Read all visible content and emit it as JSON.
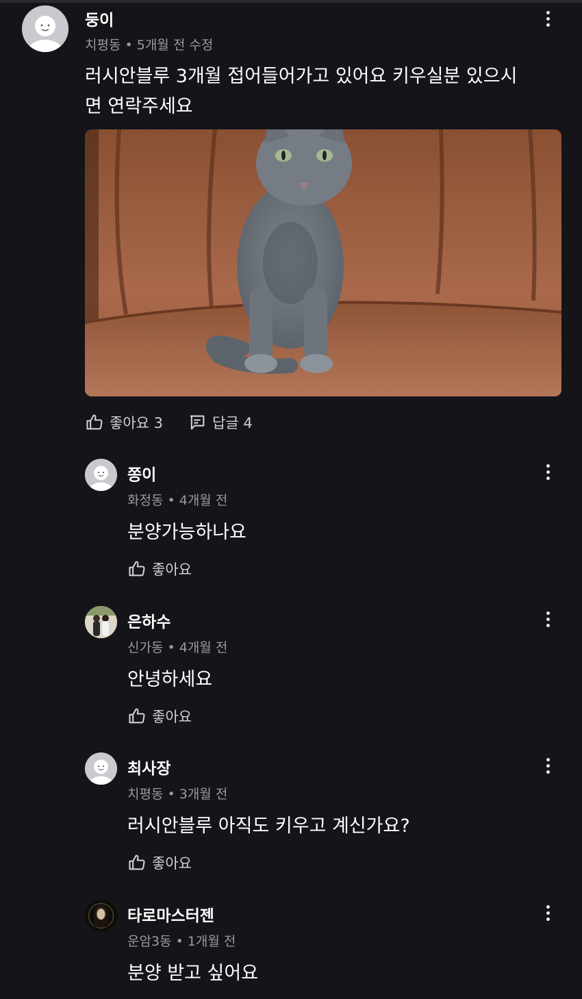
{
  "post": {
    "author": "둥이",
    "meta": "치평동 • 5개월 전 수정",
    "text_line1": "러시안블루 3개월 접어들어가고 있어요 키우실분 있으시",
    "text_line2": "면 연락주세요",
    "like_label": "좋아요 3",
    "reply_label": "답글 4"
  },
  "replies": [
    {
      "author": "쫑이",
      "meta": "화정동 • 4개월 전",
      "text": "분양가능하나요",
      "like_label": "좋아요"
    },
    {
      "author": "은하수",
      "meta": "신가동 • 4개월 전",
      "text": "안녕하세요",
      "like_label": "좋아요"
    },
    {
      "author": "최사장",
      "meta": "치평동 • 3개월 전",
      "text": "러시안블루 아직도 키우고 계신가요?",
      "like_label": "좋아요"
    },
    {
      "author": "타로마스터젠",
      "meta": "운암3동 • 1개월 전",
      "text": "분양 받고 싶어요"
    }
  ],
  "colors": {
    "background": "#141419",
    "meta_text": "#9a9aa2",
    "action_text": "#d0d0d6"
  },
  "icons": [
    "profile-placeholder-icon",
    "more-vertical-icon",
    "thumbs-up-icon",
    "comment-icon"
  ]
}
